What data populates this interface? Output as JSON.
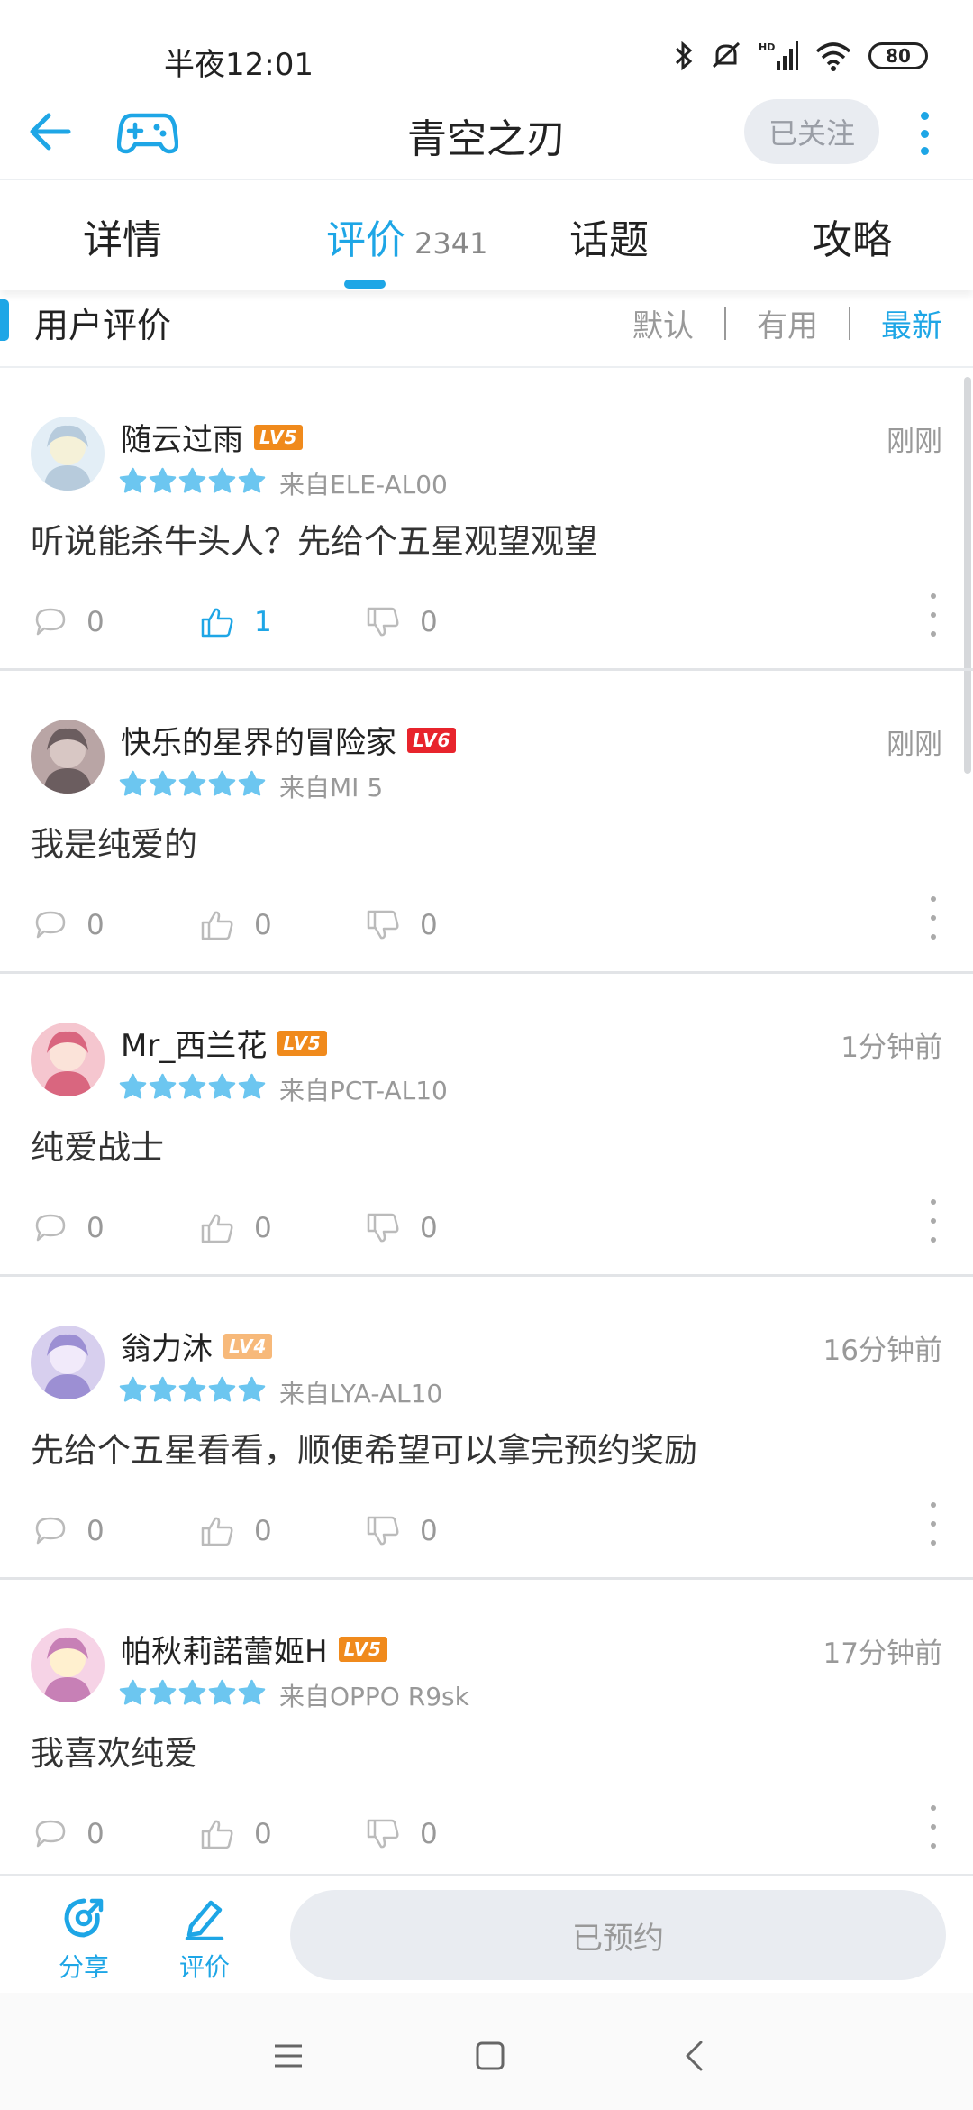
{
  "status_bar": {
    "time": "半夜12:01",
    "battery": "80"
  },
  "header": {
    "title": "青空之刃",
    "follow_label": "已关注"
  },
  "tabs": [
    {
      "label": "详情",
      "count": ""
    },
    {
      "label": "评价",
      "count": "2341"
    },
    {
      "label": "话题",
      "count": ""
    },
    {
      "label": "攻略",
      "count": ""
    }
  ],
  "section": {
    "title": "用户评价",
    "sort_options": [
      "默认",
      "有用",
      "最新"
    ],
    "active_sort": "最新"
  },
  "reviews": [
    {
      "user": "随云过雨",
      "level": "LV5",
      "level_color": "#f08a1c",
      "stars": 5,
      "device": "来自ELE-AL00",
      "time": "刚刚",
      "content": "听说能杀牛头人？先给个五星观望观望",
      "comments": "0",
      "likes": "1",
      "dislikes": "0",
      "liked": true
    },
    {
      "user": "快乐的星界的冒险家",
      "level": "LV6",
      "level_color": "#e8242c",
      "stars": 5,
      "device": "来自MI 5",
      "time": "刚刚",
      "content": "我是纯爱的",
      "comments": "0",
      "likes": "0",
      "dislikes": "0",
      "liked": false
    },
    {
      "user": "Mr_西兰花",
      "level": "LV5",
      "level_color": "#f08a1c",
      "stars": 5,
      "device": "来自PCT-AL10",
      "time": "1分钟前",
      "content": "纯爱战士",
      "comments": "0",
      "likes": "0",
      "dislikes": "0",
      "liked": false
    },
    {
      "user": "翁力沐",
      "level": "LV4",
      "level_color": "#f7b97a",
      "stars": 5,
      "device": "来自LYA-AL10",
      "time": "16分钟前",
      "content": "先给个五星看看，顺便希望可以拿完预约奖励",
      "comments": "0",
      "likes": "0",
      "dislikes": "0",
      "liked": false
    },
    {
      "user": "帕秋莉諾蕾姬H",
      "level": "LV5",
      "level_color": "#f08a1c",
      "stars": 5,
      "device": "来自OPPO R9sk",
      "time": "17分钟前",
      "content": "我喜欢纯爱",
      "comments": "0",
      "likes": "0",
      "dislikes": "0",
      "liked": false
    }
  ],
  "bottom_bar": {
    "share_label": "分享",
    "review_label": "评价",
    "reserved_label": "已预约"
  },
  "colors": {
    "accent": "#1ea6e6",
    "star": "#6cc6f0"
  }
}
